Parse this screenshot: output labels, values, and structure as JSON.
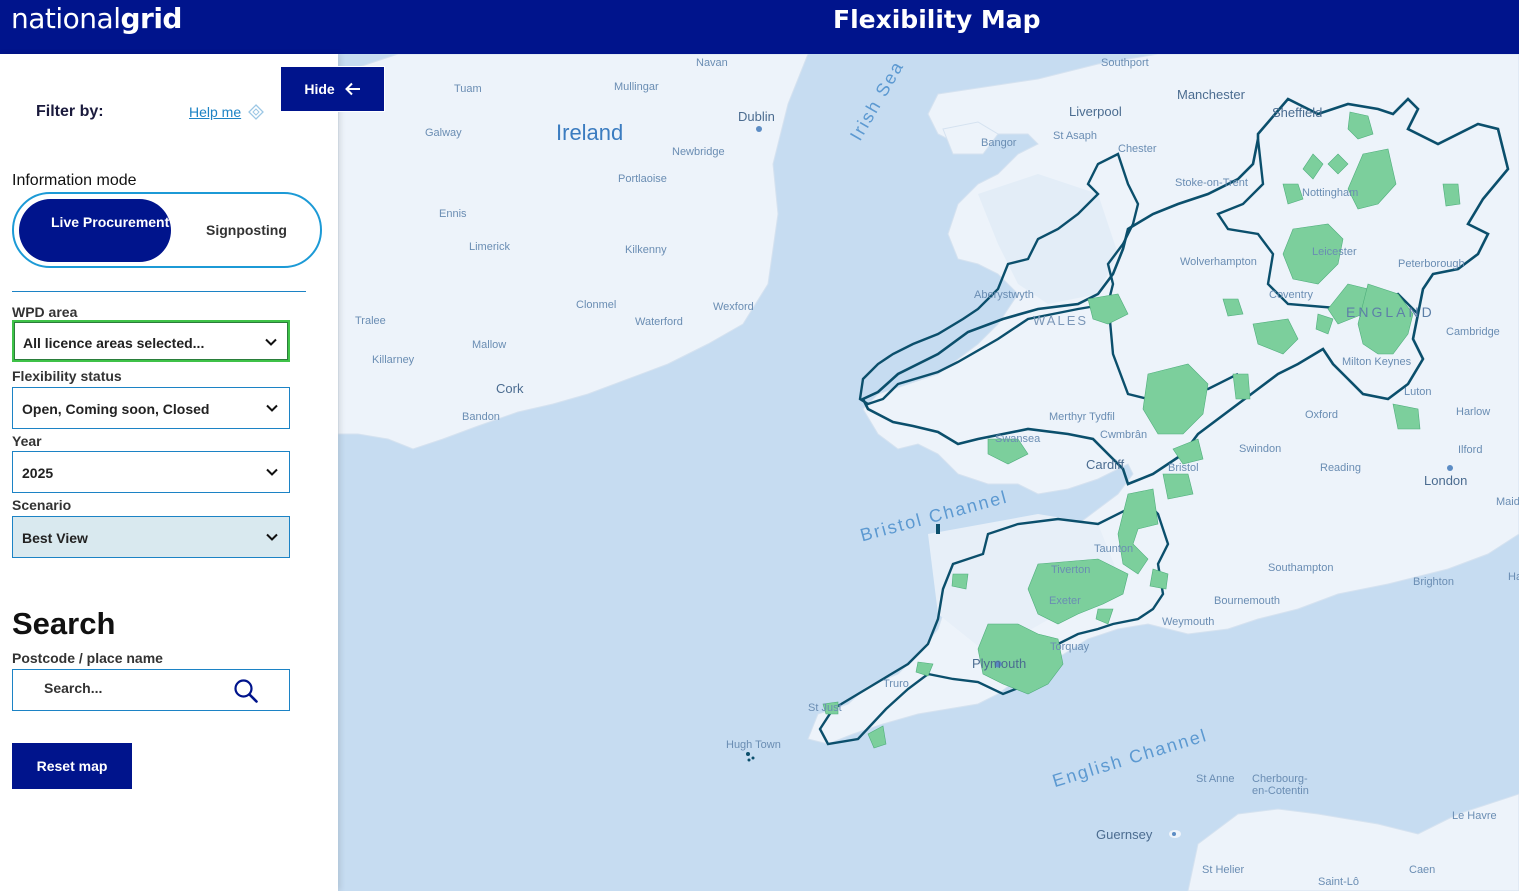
{
  "header": {
    "logo_light": "national",
    "logo_bold": "grid",
    "title": "Flexibility Map"
  },
  "sidebar": {
    "filter_label": "Filter by:",
    "help_link": "Help me",
    "hide_button": "Hide",
    "information_mode_label": "Information mode",
    "mode_options": [
      "Live Procurement",
      "Signposting"
    ],
    "selected_mode": "Live Procurement",
    "wpd_area": {
      "label": "WPD area",
      "value": "All licence areas selected..."
    },
    "flexibility_status": {
      "label": "Flexibility status",
      "value": "Open, Coming soon, Closed"
    },
    "year": {
      "label": "Year",
      "value": "2025"
    },
    "scenario": {
      "label": "Scenario",
      "value": "Best View"
    },
    "search_title": "Search",
    "search_label": "Postcode / place name",
    "search_placeholder": "Search...",
    "reset_button": "Reset map"
  },
  "colors": {
    "brand_navy": "#00148c",
    "accent_blue": "#1c83c5",
    "map_water": "#c6dcf1",
    "map_land": "#edf3fa",
    "region_border": "#0b4f6c",
    "flex_zone_green": "#7ccf9c",
    "focus_green": "#3fc248"
  },
  "map": {
    "places": [
      "Navan",
      "Tuam",
      "Mullingar",
      "Dublin",
      "Ireland",
      "Galway",
      "Newbridge",
      "Portlaoise",
      "Ennis",
      "Limerick",
      "Kilkenny",
      "Clonmel",
      "Wexford",
      "Tralee",
      "Mallow",
      "Waterford",
      "Killarney",
      "Cork",
      "Bandon",
      "Irish Sea",
      "Southport",
      "Manchester",
      "Sheffield",
      "Liverpool",
      "St Asaph",
      "Bangor",
      "Chester",
      "Stoke-on-Trent",
      "Nottingham",
      "Leicester",
      "Wolverhampton",
      "Peterborough",
      "Aberystwyth",
      "Coventry",
      "WALES",
      "ENGLAND",
      "Cambridge",
      "Milton Keynes",
      "Luton",
      "Oxford",
      "Harlow",
      "Merthyr Tydfil",
      "Cwmbrân",
      "Swansea",
      "Ilford",
      "Swindon",
      "Cardiff",
      "Bristol",
      "Reading",
      "London",
      "Bristol Channel",
      "Maid",
      "Taunton",
      "Southampton",
      "Brighton",
      "Ha",
      "Tiverton",
      "Exeter",
      "Bournemouth",
      "Weymouth",
      "Torquay",
      "Plymouth",
      "Truro",
      "St Just",
      "Hugh Town",
      "English Channel",
      "St Anne",
      "Cherbourg-en-Cotentin",
      "Le Havre",
      "Guernsey",
      "St Helier",
      "Caen",
      "Saint-Lô"
    ]
  }
}
